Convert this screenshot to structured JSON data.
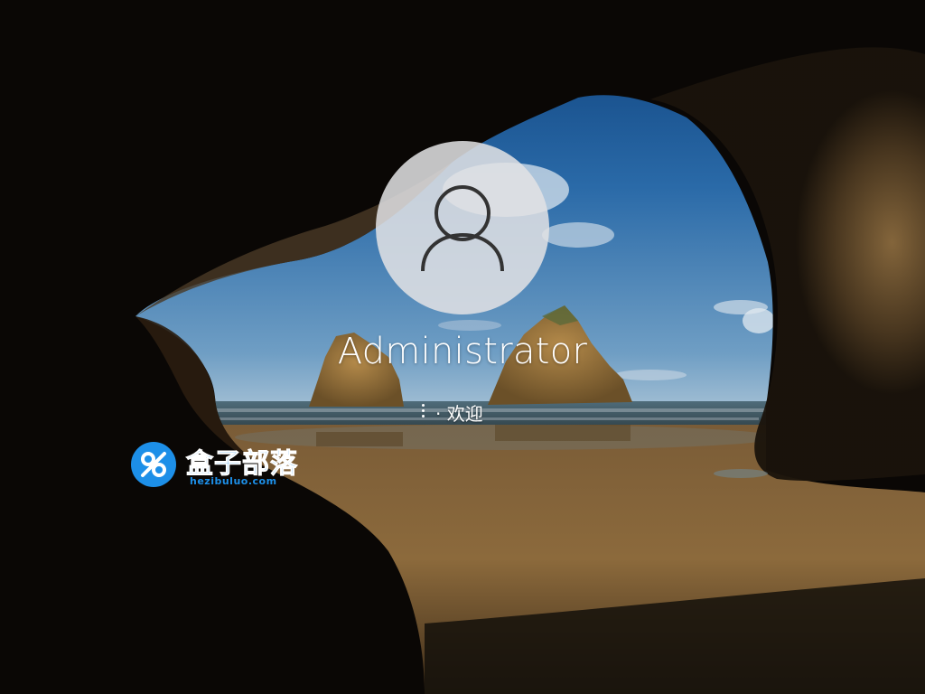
{
  "user": {
    "name": "Administrator",
    "avatar_icon": "user-silhouette-icon"
  },
  "status": {
    "text": "· 欢迎",
    "spinner_icon": "loading-dots-icon"
  },
  "watermark": {
    "title": "盒子部落",
    "url": "hezibuluo.com",
    "color": "#1d8fe8",
    "logo_icon": "hezibuluo-logo-icon"
  },
  "background": {
    "scene": "beach-cave-wallpaper-icon"
  }
}
